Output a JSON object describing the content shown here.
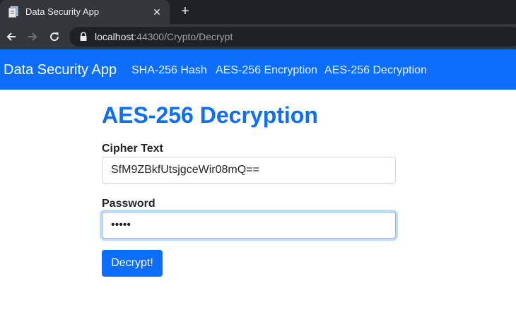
{
  "browser": {
    "tab_title": "Data Security App",
    "close_glyph": "✕",
    "new_tab_glyph": "+",
    "url_host": "localhost",
    "url_rest": ":44300/Crypto/Decrypt"
  },
  "navbar": {
    "brand": "Data Security App",
    "links": [
      "SHA-256 Hash",
      "AES-256 Encryption",
      "AES-256 Decryption"
    ]
  },
  "form": {
    "title": "AES-256 Decryption",
    "cipher_label": "Cipher Text",
    "cipher_value": "SfM9ZBkfUtsjgceWir08mQ==",
    "password_label": "Password",
    "password_value": "•••••",
    "submit_label": "Decrypt!"
  },
  "colors": {
    "primary": "#0d6efd",
    "chrome_dark": "#202124",
    "chrome_tab": "#35363a"
  }
}
